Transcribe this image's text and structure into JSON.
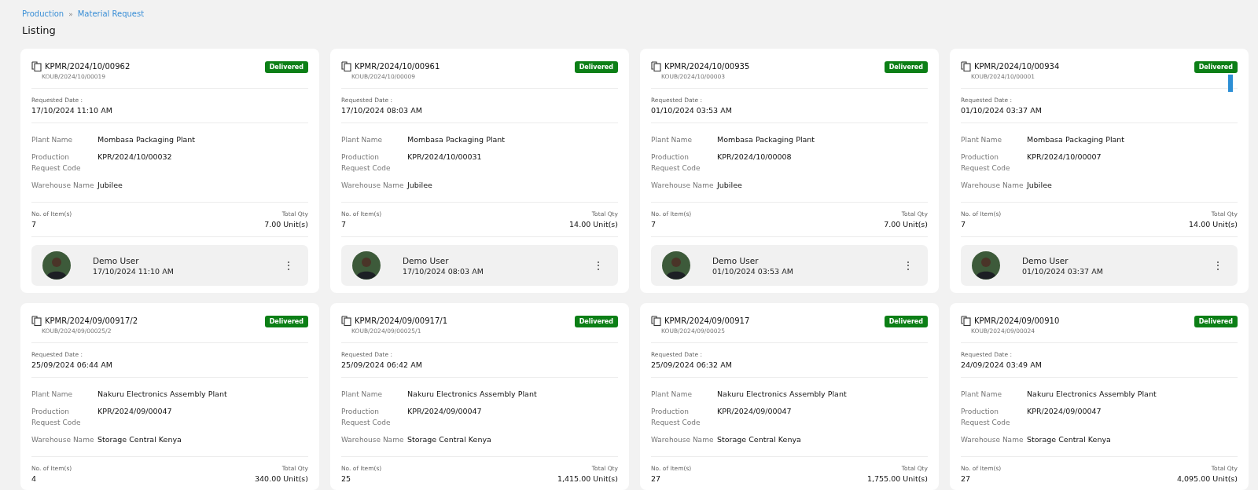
{
  "breadcrumb": [
    "Production",
    "Material Request"
  ],
  "breadcrumb_separator": "»",
  "title": "Listing",
  "cards": [
    {
      "code": "KPMR/2024/10/00962",
      "sub_code": "KOUB/2024/10/00019",
      "status": "Delivered",
      "date_label": "Requested Date :",
      "date": "17/10/2024 11:10 AM",
      "fields": [
        {
          "label": "Plant Name",
          "value": "Mombasa Packaging Plant"
        },
        {
          "label": "Production Request Code",
          "value": "KPR/2024/10/00032"
        },
        {
          "label": "Warehouse Name",
          "value": "Jubilee"
        }
      ],
      "items_label": "No. of Item(s)",
      "items": "7",
      "qty_label": "Total Qty",
      "qty": "7.00 Unit(s)",
      "user": {
        "name": "Demo User",
        "time": "17/10/2024 11:10 AM",
        "menu": "⋮"
      }
    },
    {
      "code": "KPMR/2024/10/00961",
      "sub_code": "KOUB/2024/10/00009",
      "status": "Delivered",
      "date_label": "Requested Date :",
      "date": "17/10/2024 08:03 AM",
      "fields": [
        {
          "label": "Plant Name",
          "value": "Mombasa Packaging Plant"
        },
        {
          "label": "Production Request Code",
          "value": "KPR/2024/10/00031"
        },
        {
          "label": "Warehouse Name",
          "value": "Jubilee"
        }
      ],
      "items_label": "No. of Item(s)",
      "items": "7",
      "qty_label": "Total Qty",
      "qty": "14.00 Unit(s)",
      "user": {
        "name": "Demo User",
        "time": "17/10/2024 08:03 AM",
        "menu": "⋮"
      }
    },
    {
      "code": "KPMR/2024/10/00935",
      "sub_code": "KOUB/2024/10/00003",
      "status": "Delivered",
      "date_label": "Requested Date :",
      "date": "01/10/2024 03:53 AM",
      "fields": [
        {
          "label": "Plant Name",
          "value": "Mombasa Packaging Plant"
        },
        {
          "label": "Production Request Code",
          "value": "KPR/2024/10/00008"
        },
        {
          "label": "Warehouse Name",
          "value": "Jubilee"
        }
      ],
      "items_label": "No. of Item(s)",
      "items": "7",
      "qty_label": "Total Qty",
      "qty": "7.00 Unit(s)",
      "user": {
        "name": "Demo User",
        "time": "01/10/2024 03:53 AM",
        "menu": "⋮"
      }
    },
    {
      "code": "KPMR/2024/10/00934",
      "sub_code": "KOUB/2024/10/00001",
      "status": "Delivered",
      "date_label": "Requested Date :",
      "date": "01/10/2024 03:37 AM",
      "fields": [
        {
          "label": "Plant Name",
          "value": "Mombasa Packaging Plant"
        },
        {
          "label": "Production Request Code",
          "value": "KPR/2024/10/00007"
        },
        {
          "label": "Warehouse Name",
          "value": "Jubilee"
        }
      ],
      "items_label": "No. of Item(s)",
      "items": "7",
      "qty_label": "Total Qty",
      "qty": "14.00 Unit(s)",
      "user": {
        "name": "Demo User",
        "time": "01/10/2024 03:37 AM",
        "menu": "⋮"
      }
    },
    {
      "code": "KPMR/2024/09/00917/2",
      "sub_code": "KOUB/2024/09/00025/2",
      "status": "Delivered",
      "date_label": "Requested Date :",
      "date": "25/09/2024 06:44 AM",
      "fields": [
        {
          "label": "Plant Name",
          "value": "Nakuru Electronics Assembly Plant"
        },
        {
          "label": "Production Request Code",
          "value": "KPR/2024/09/00047"
        },
        {
          "label": "Warehouse Name",
          "value": "Storage Central Kenya"
        }
      ],
      "items_label": "No. of Item(s)",
      "items": "4",
      "qty_label": "Total Qty",
      "qty": "340.00 Unit(s)"
    },
    {
      "code": "KPMR/2024/09/00917/1",
      "sub_code": "KOUB/2024/09/00025/1",
      "status": "Delivered",
      "date_label": "Requested Date :",
      "date": "25/09/2024 06:42 AM",
      "fields": [
        {
          "label": "Plant Name",
          "value": "Nakuru Electronics Assembly Plant"
        },
        {
          "label": "Production Request Code",
          "value": "KPR/2024/09/00047"
        },
        {
          "label": "Warehouse Name",
          "value": "Storage Central Kenya"
        }
      ],
      "items_label": "No. of Item(s)",
      "items": "25",
      "qty_label": "Total Qty",
      "qty": "1,415.00 Unit(s)"
    },
    {
      "code": "KPMR/2024/09/00917",
      "sub_code": "KOUB/2024/09/00025",
      "status": "Delivered",
      "date_label": "Requested Date :",
      "date": "25/09/2024 06:32 AM",
      "fields": [
        {
          "label": "Plant Name",
          "value": "Nakuru Electronics Assembly Plant"
        },
        {
          "label": "Production Request Code",
          "value": "KPR/2024/09/00047"
        },
        {
          "label": "Warehouse Name",
          "value": "Storage Central Kenya"
        }
      ],
      "items_label": "No. of Item(s)",
      "items": "27",
      "qty_label": "Total Qty",
      "qty": "1,755.00 Unit(s)"
    },
    {
      "code": "KPMR/2024/09/00910",
      "sub_code": "KOUB/2024/09/00024",
      "status": "Delivered",
      "date_label": "Requested Date :",
      "date": "24/09/2024 03:49 AM",
      "fields": [
        {
          "label": "Plant Name",
          "value": "Nakuru Electronics Assembly Plant"
        },
        {
          "label": "Production Request Code",
          "value": "KPR/2024/09/00047"
        },
        {
          "label": "Warehouse Name",
          "value": "Storage Central Kenya"
        }
      ],
      "items_label": "No. of Item(s)",
      "items": "27",
      "qty_label": "Total Qty",
      "qty": "4,095.00 Unit(s)"
    }
  ]
}
